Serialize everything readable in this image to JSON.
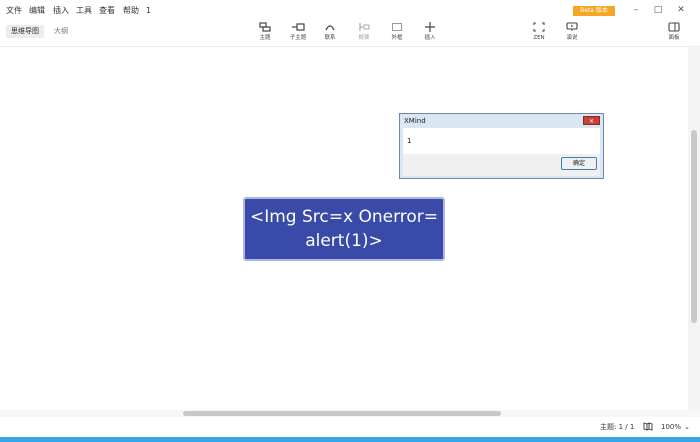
{
  "menu": {
    "items": [
      "文件",
      "编辑",
      "插入",
      "工具",
      "查看",
      "帮助",
      "1"
    ]
  },
  "beta_badge": "Beta 版本",
  "window_controls": {
    "minimize": "–",
    "maximize": "□",
    "close": "✕"
  },
  "view_tabs": [
    {
      "label": "思维导图",
      "active": true
    },
    {
      "label": "大纲",
      "active": false
    }
  ],
  "toolbar": {
    "topic": {
      "label": "主题",
      "icon": "topic-icon"
    },
    "subtopic": {
      "label": "子主题",
      "icon": "subtopic-icon"
    },
    "relationship": {
      "label": "联系",
      "icon": "relationship-icon"
    },
    "summary": {
      "label": "概要",
      "icon": "summary-icon"
    },
    "boundary": {
      "label": "外框",
      "icon": "boundary-icon"
    },
    "insert": {
      "label": "插入",
      "icon": "plus-icon"
    },
    "zen": {
      "label": "ZEN",
      "icon": "expand-icon"
    },
    "present": {
      "label": "演说",
      "icon": "presentation-icon"
    },
    "panel": {
      "label": "面板",
      "icon": "panel-icon"
    }
  },
  "canvas": {
    "central_topic": {
      "line1": "<Img Src=x Onerror=",
      "line2": "alert(1)>",
      "color": "#3a4aa8"
    }
  },
  "dialog": {
    "title": "XMind",
    "message": "1",
    "ok_label": "确定",
    "close_glyph": "✕"
  },
  "status": {
    "topic_count": "主题: 1 / 1",
    "zoom": "100%",
    "zoom_arrow": "⌄"
  },
  "colors": {
    "accent": "#3a4aa8",
    "beta": "#f5a623",
    "taskbar": "#37a6e8"
  }
}
